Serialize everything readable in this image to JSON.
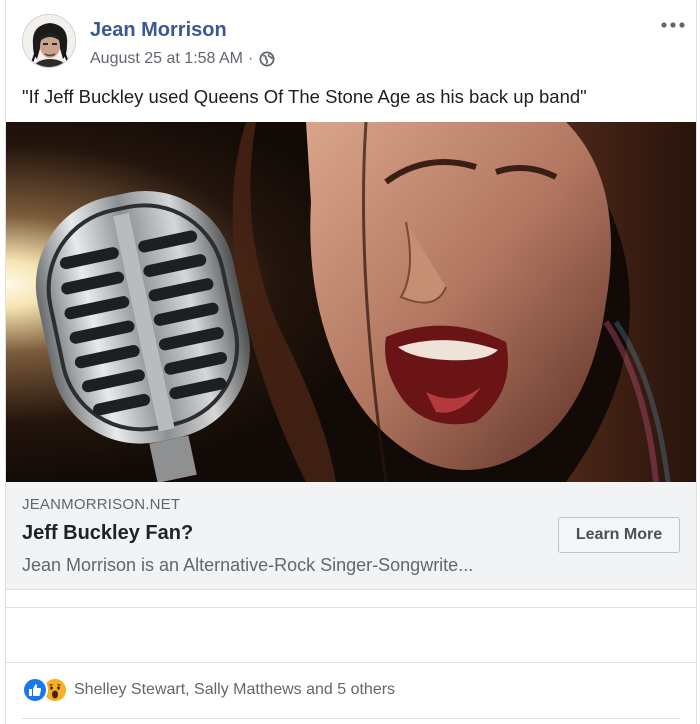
{
  "post": {
    "author": "Jean Morrison",
    "timestamp": "August 25 at 1:58 AM",
    "separator": "·",
    "privacy_icon": "globe-icon",
    "more_icon": "more-options-icon",
    "text": "\"If Jeff Buckley used Queens Of The Stone Age as his back up band\""
  },
  "link_preview": {
    "domain": "JEANMORRISON.NET",
    "title": "Jeff Buckley Fan?",
    "description": "Jean Morrison is an Alternative-Rock Singer-Songwrite...",
    "cta_label": "Learn More"
  },
  "reactions": {
    "icons": [
      "like-icon",
      "wow-icon"
    ],
    "names": "Shelley Stewart, Sally Matthews and 5 others"
  },
  "colors": {
    "author_link": "#385898",
    "secondary_text": "#606770",
    "link_box_bg": "#f2f3f5",
    "like_blue": "#1877f2",
    "wow_yellow": "#f7b125"
  }
}
